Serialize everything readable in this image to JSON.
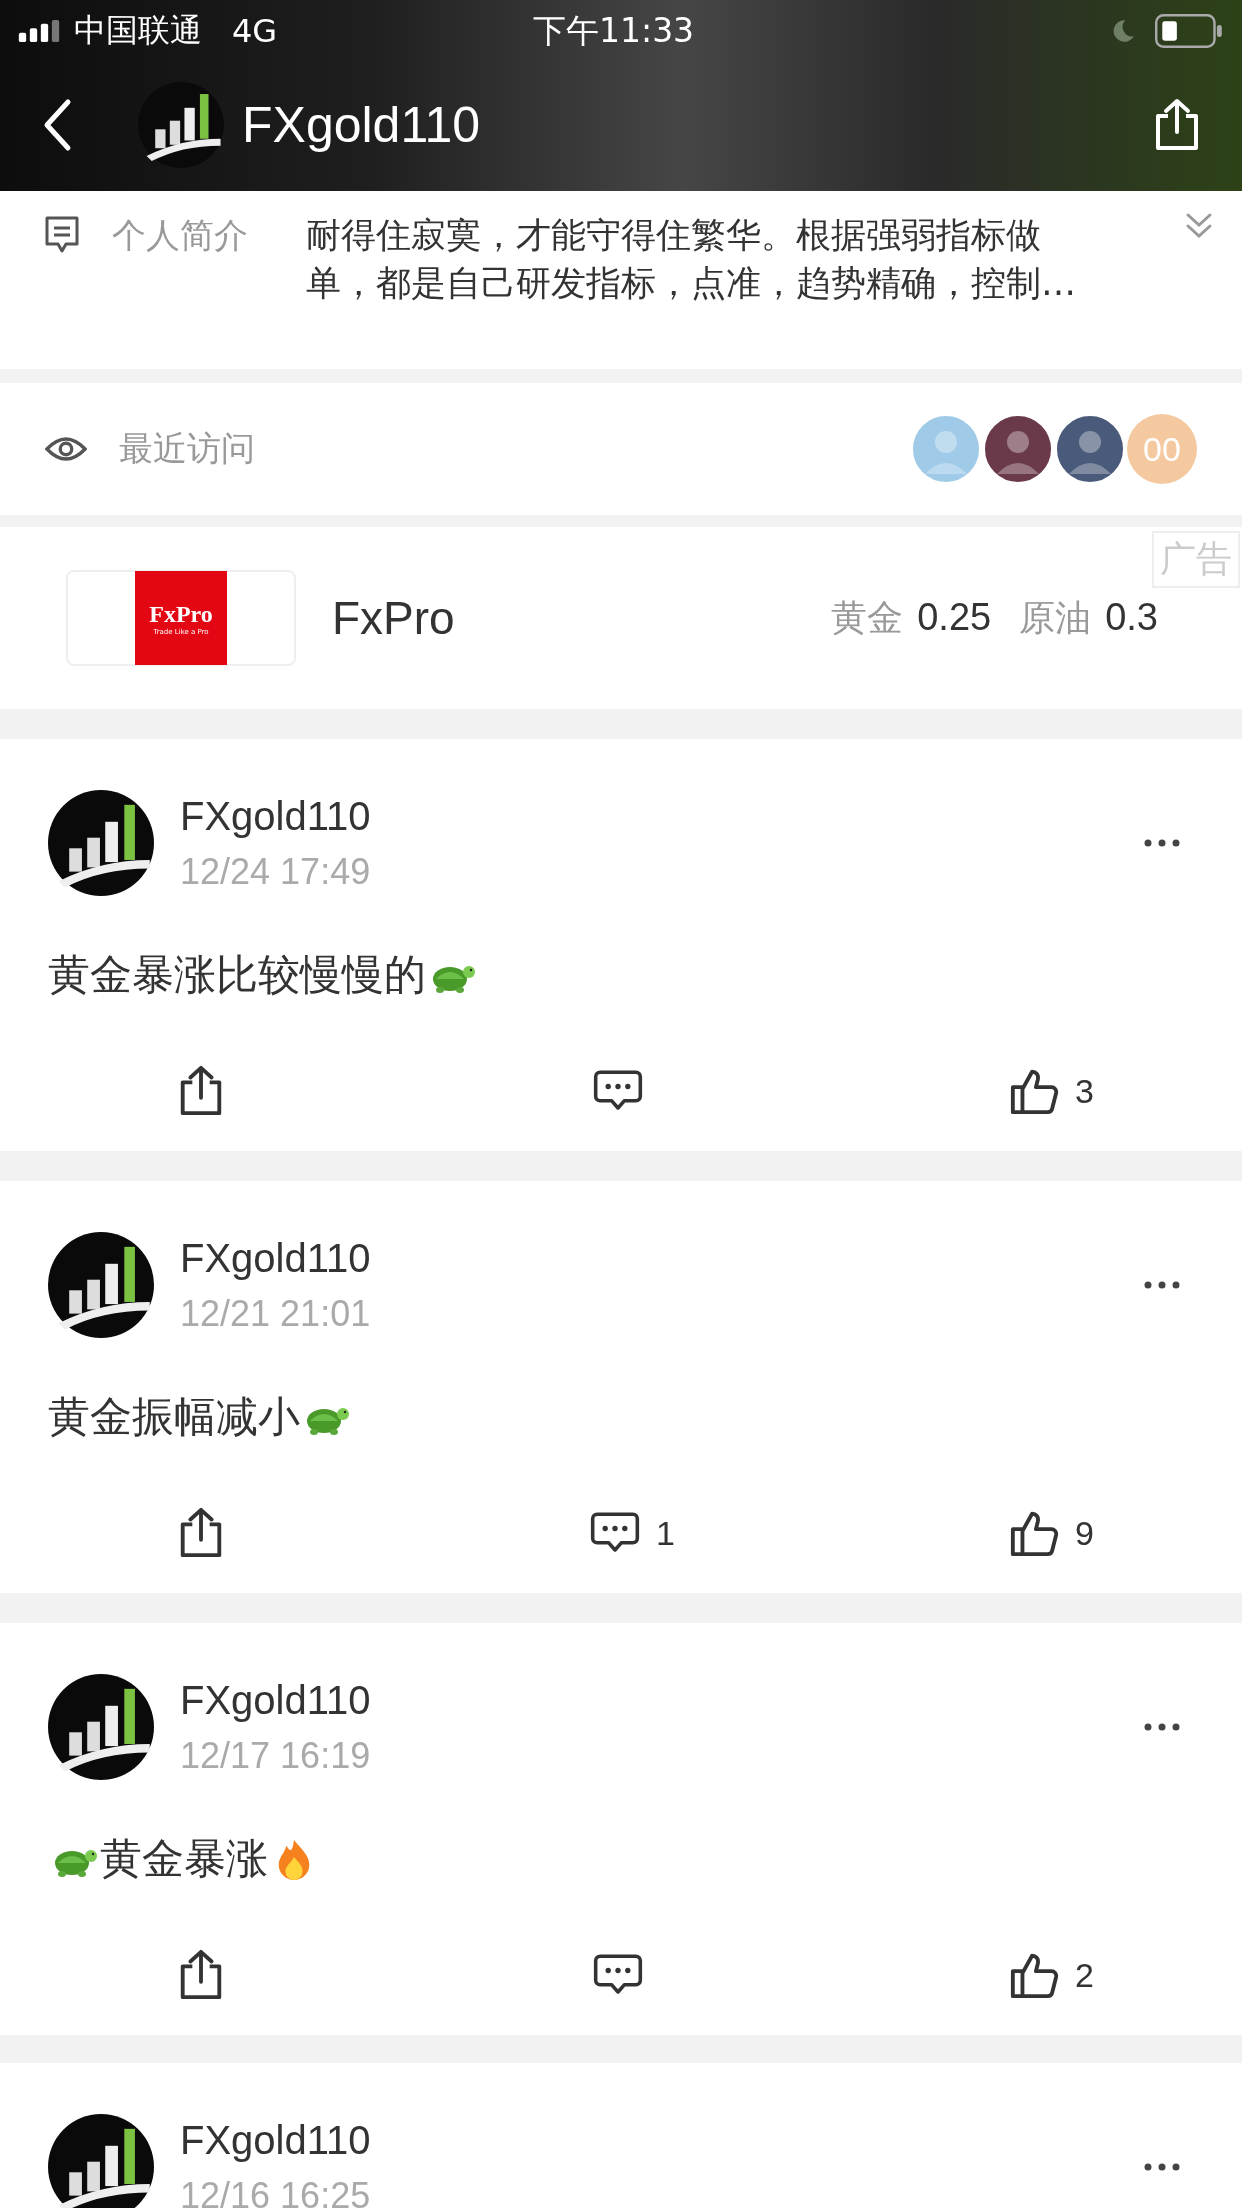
{
  "status_bar": {
    "carrier": "中国联通",
    "network": "4G",
    "time": "下午11:33"
  },
  "header": {
    "title": "FXgold110"
  },
  "bio": {
    "label": "个人简介",
    "text": "耐得住寂寞，才能守得住繁华。根据强弱指标做单，都是自己研发指标，点准，趋势精确，控制…"
  },
  "visitors": {
    "label": "最近访问",
    "avatars": [
      {
        "kind": "photo",
        "color": "#9fcbe8"
      },
      {
        "kind": "photo",
        "color": "#6a3a4a"
      },
      {
        "kind": "photo",
        "color": "#4a5a7a"
      },
      {
        "kind": "count",
        "text": "00",
        "color": "#f5c9a0"
      }
    ]
  },
  "ad": {
    "badge": "广告",
    "logo_text": "FxPro",
    "logo_tagline": "Trade Like a Pro",
    "name": "FxPro",
    "quotes": [
      {
        "label": "黄金",
        "value": "0.25"
      },
      {
        "label": "原油",
        "value": "0.3"
      }
    ]
  },
  "posts": [
    {
      "author": "FXgold110",
      "time": "12/24 17:49",
      "content": [
        {
          "kind": "text",
          "text": "黄金暴涨比较慢慢的"
        },
        {
          "kind": "turtle"
        }
      ],
      "likes": "3"
    },
    {
      "author": "FXgold110",
      "time": "12/21 21:01",
      "content": [
        {
          "kind": "text",
          "text": "黄金振幅减小"
        },
        {
          "kind": "turtle"
        }
      ],
      "comments": "1",
      "likes": "9"
    },
    {
      "author": "FXgold110",
      "time": "12/17 16:19",
      "content": [
        {
          "kind": "turtle"
        },
        {
          "kind": "text",
          "text": "黄金暴涨"
        },
        {
          "kind": "fire"
        }
      ],
      "likes": "2"
    },
    {
      "author": "FXgold110",
      "time": "12/16 16:25"
    }
  ]
}
